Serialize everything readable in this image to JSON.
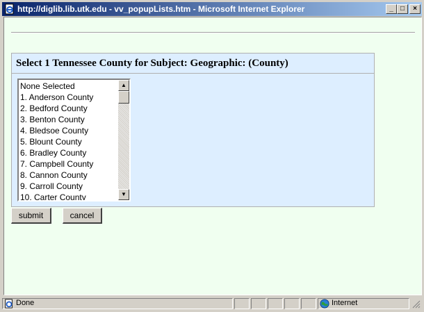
{
  "window": {
    "title": "http://diglib.lib.utk.edu - vv_popupLists.htm - Microsoft Internet Explorer"
  },
  "panel": {
    "title": "Select 1 Tennessee County for Subject: Geographic: (County)"
  },
  "listbox": {
    "items": [
      "None Selected",
      "1. Anderson County",
      "2. Bedford County",
      "3. Benton County",
      "4. Bledsoe County",
      "5. Blount County",
      "6. Bradley County",
      "7. Campbell County",
      "8. Cannon County",
      "9. Carroll County",
      "10. Carter County"
    ]
  },
  "buttons": {
    "submit": "submit",
    "cancel": "cancel"
  },
  "statusbar": {
    "status": "Done",
    "zone": "Internet"
  },
  "icons": {
    "title_icon": "ie-page-icon",
    "status_icon": "ie-page-icon",
    "zone_icon": "globe-icon"
  }
}
